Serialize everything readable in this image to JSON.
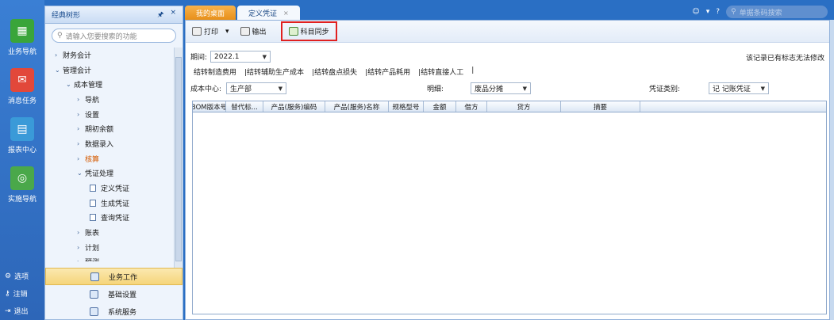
{
  "leftnav": {
    "items": [
      {
        "label": "业务导航",
        "icon": "business-nav-icon",
        "color": "#3aa53a"
      },
      {
        "label": "消息任务",
        "icon": "message-task-icon",
        "color": "#e2483a"
      },
      {
        "label": "报表中心",
        "icon": "report-center-icon",
        "color": "#3a9ad8"
      },
      {
        "label": "实施导航",
        "icon": "implementation-nav-icon",
        "color": "#4aa84a"
      }
    ],
    "bottom": [
      {
        "label": "选项",
        "icon": "gear-icon"
      },
      {
        "label": "注销",
        "icon": "key-icon"
      },
      {
        "label": "退出",
        "icon": "exit-icon"
      }
    ]
  },
  "tree": {
    "title": "经典树形",
    "pin": "🖈",
    "close": "×",
    "search_placeholder": "请输入您要搜索的功能",
    "items": [
      {
        "label": "财务会计",
        "level": 0,
        "arrow": "›"
      },
      {
        "label": "管理会计",
        "level": 0,
        "arrow": "⌄"
      },
      {
        "label": "成本管理",
        "level": 1,
        "arrow": "⌄"
      },
      {
        "label": "导航",
        "level": 2,
        "arrow": "›"
      },
      {
        "label": "设置",
        "level": 2,
        "arrow": "›"
      },
      {
        "label": "期初余额",
        "level": 2,
        "arrow": "›"
      },
      {
        "label": "数据录入",
        "level": 2,
        "arrow": "›"
      },
      {
        "label": "核算",
        "level": 2,
        "arrow": "›",
        "active": true
      },
      {
        "label": "凭证处理",
        "level": 2,
        "arrow": "⌄"
      },
      {
        "label": "定义凭证",
        "level": 3,
        "doc": true
      },
      {
        "label": "生成凭证",
        "level": 3,
        "doc": true
      },
      {
        "label": "查询凭证",
        "level": 3,
        "doc": true
      },
      {
        "label": "账表",
        "level": 2,
        "arrow": "›"
      },
      {
        "label": "计划",
        "level": 2,
        "arrow": "›"
      },
      {
        "label": "预测",
        "level": 2,
        "arrow": "›"
      }
    ],
    "bottom": [
      {
        "label": "业务工作",
        "selected": true
      },
      {
        "label": "基础设置"
      },
      {
        "label": "系统服务"
      }
    ]
  },
  "tabs": [
    {
      "label": "我的桌面"
    },
    {
      "label": "定义凭证",
      "close": "×"
    }
  ],
  "topright": {
    "search_placeholder": "单据条码搜索"
  },
  "toolbar": {
    "print": "打印",
    "print_caret": "▾",
    "export": "输出",
    "sync": "科目同步"
  },
  "period": {
    "label": "期间:",
    "value": "2022.1"
  },
  "lock_note": "该记录已有标志无法修改",
  "links": [
    "结转制造费用",
    "|结转辅助生产成本",
    "|结转盘点损失",
    "|结转产品耗用",
    "|结转直接人工",
    "|"
  ],
  "filters": {
    "cost_center_label": "成本中心:",
    "cost_center_value": "生产部",
    "detail_label": "明细:",
    "detail_value": "废品分摊",
    "voucher_type_label": "凭证类别:",
    "voucher_type_value": "记 记账凭证"
  },
  "grid": {
    "columns": [
      "BOM版本号",
      "替代标...",
      "产品(服务)编码",
      "产品(服务)名称",
      "规格型号",
      "金额",
      "借方",
      "贷方",
      "摘要"
    ]
  }
}
